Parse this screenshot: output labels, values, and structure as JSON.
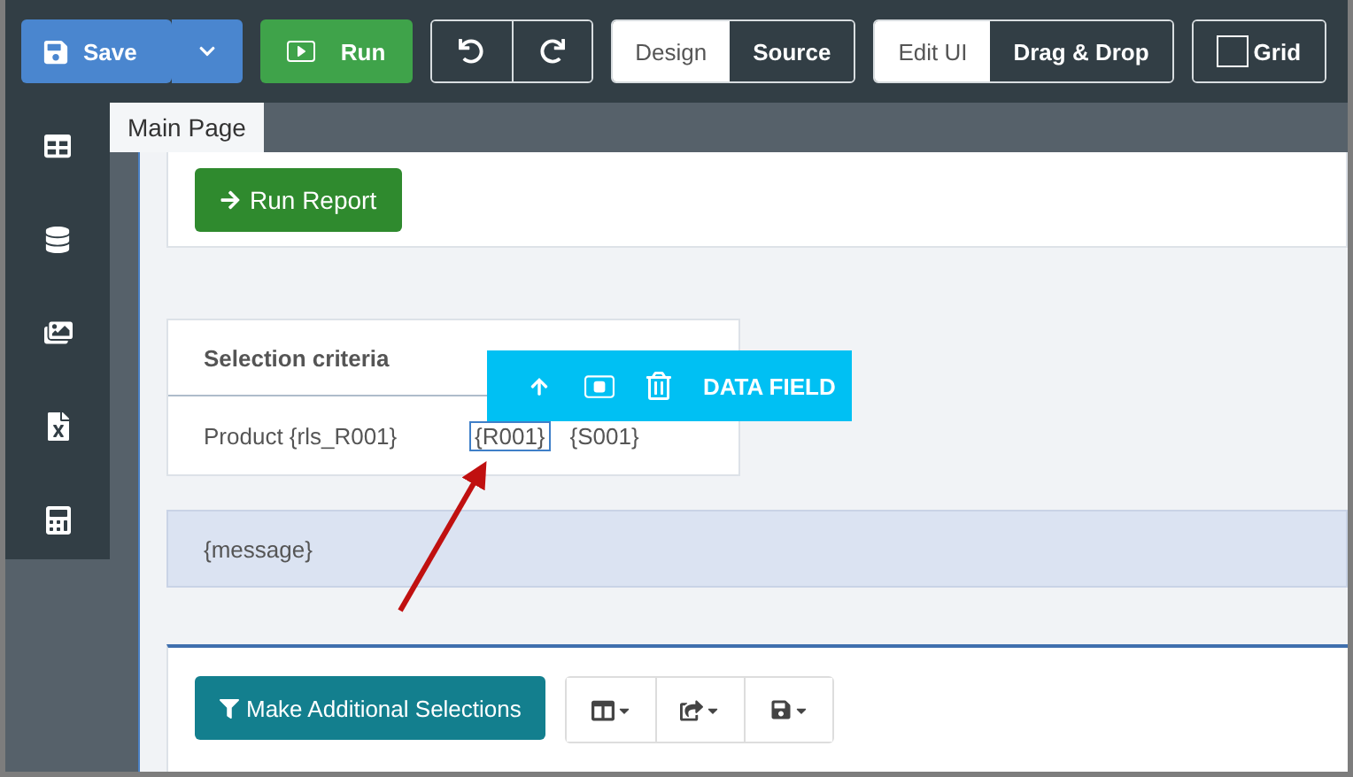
{
  "toolbar": {
    "save": {
      "label": "Save"
    },
    "run": {
      "label": "Run"
    },
    "toggle_groups": [
      [
        {
          "label": "Design",
          "selected": false
        },
        {
          "label": "Source",
          "selected": true
        }
      ],
      [
        {
          "label": "Edit UI",
          "selected": false
        },
        {
          "label": "Drag & Drop",
          "selected": true
        }
      ]
    ],
    "grid": {
      "label": "Grid",
      "checked": false
    }
  },
  "tabs": [
    {
      "label": "Main Page",
      "selected": true
    }
  ],
  "run_report": {
    "label": "Run Report"
  },
  "selection": {
    "title": "Selection criteria",
    "label": "Product {rls_R001}",
    "fields": [
      {
        "text": "{R001}",
        "selected": true
      },
      {
        "text": "{S001}",
        "selected": false
      }
    ]
  },
  "popup": {
    "label": "DATA FIELD"
  },
  "message": "{message}",
  "additional": {
    "label": "Make Additional Selections"
  }
}
